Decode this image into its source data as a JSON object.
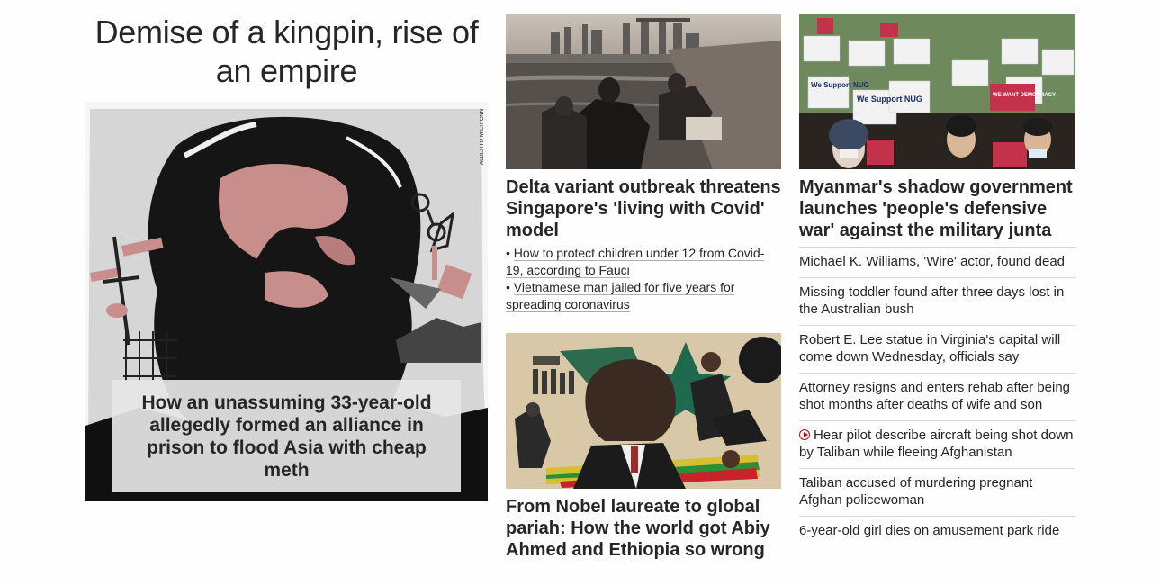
{
  "lead": {
    "title": "Demise of a kingpin, rise of an empire",
    "image_credit": "ALBERTO MIER/CNN",
    "caption": "How an unassuming 33-year-old allegedly formed an alliance in prison to flood Asia with cheap meth"
  },
  "middle": {
    "story1": {
      "headline": "Delta variant outbreak threatens Singapore's 'living with Covid' model",
      "related": [
        "How to protect children under 12 from Covid-19, according to Fauci",
        "Vietnamese man jailed for five years for spreading coronavirus"
      ]
    },
    "story2": {
      "headline": "From Nobel laureate to global pariah: How the world got Abiy Ahmed and Ethiopia so wrong"
    }
  },
  "right": {
    "headline": "Myanmar's shadow government launches 'people's defensive war' against the military junta",
    "sign_texts": [
      "We Support NUG",
      "WE WANT DEMOCRACY"
    ],
    "list": [
      "Michael K. Williams, 'Wire' actor, found dead",
      "Missing toddler found after three days lost in the Australian bush",
      "Robert E. Lee statue in Virginia's capital will come down Wednesday, officials say",
      "Attorney resigns and enters rehab after being shot months after deaths of wife and son",
      "Hear pilot describe aircraft being shot down by Taliban while fleeing Afghanistan",
      "Taliban accused of murdering pregnant Afghan policewoman",
      "6-year-old girl dies on amusement park ride"
    ]
  },
  "colors": {
    "accent": "#cc0000",
    "text": "#262626"
  }
}
